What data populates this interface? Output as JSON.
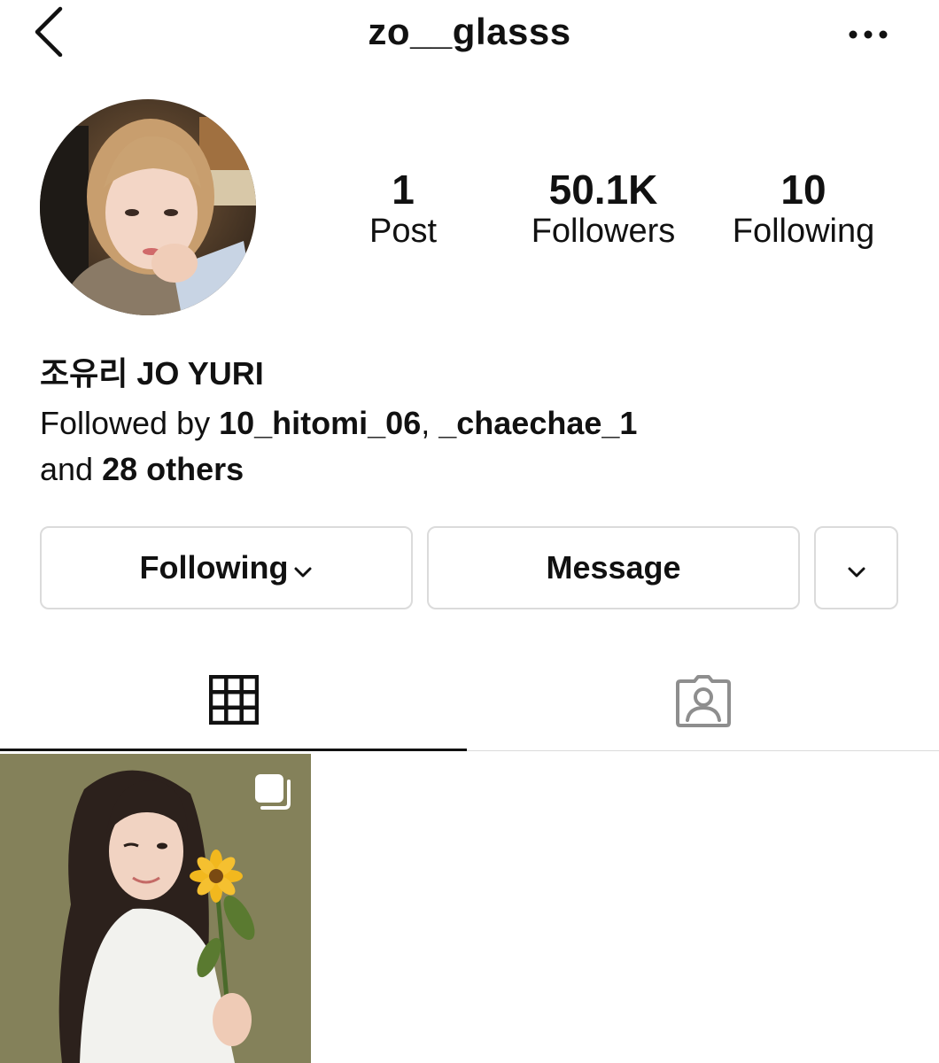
{
  "header": {
    "username": "zo__glasss",
    "back_icon": "chevron-left-icon",
    "more_icon": "ellipsis-icon"
  },
  "profile": {
    "display_name": "조유리 JO YURI",
    "stats": {
      "posts_count": "1",
      "posts_label": "Post",
      "followers_count": "50.1K",
      "followers_label": "Followers",
      "following_count": "10",
      "following_label": "Following"
    },
    "followed_by": {
      "prefix": "Followed by ",
      "user1": "10_hitomi_06",
      "separator": ", ",
      "user2": "_chaechae_1",
      "and_text": "and ",
      "others": "28 others"
    }
  },
  "actions": {
    "following_label": "Following",
    "message_label": "Message"
  },
  "tabs": [
    {
      "name": "posts-grid",
      "icon": "grid-icon",
      "active": true
    },
    {
      "name": "tagged",
      "icon": "tagged-person-icon",
      "active": false
    }
  ],
  "posts": [
    {
      "type": "carousel",
      "icon": "multiple-photos-icon"
    }
  ],
  "colors": {
    "border": "#dbdbdb",
    "text": "#111111",
    "inactive_icon": "#8e8e8e"
  }
}
